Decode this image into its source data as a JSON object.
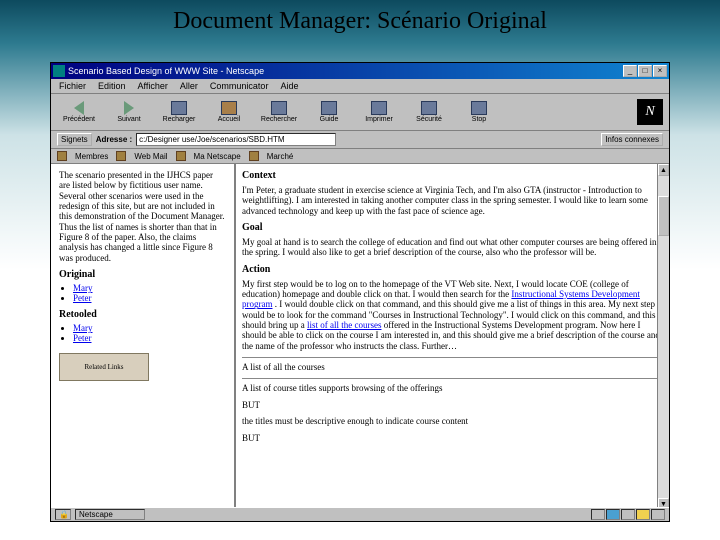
{
  "slide": {
    "title": "Document Manager: Scénario Original"
  },
  "window": {
    "title": "Scenario Based Design of WWW Site - Netscape",
    "controls": {
      "min": "_",
      "max": "□",
      "close": "×"
    }
  },
  "menubar": {
    "items": [
      "Fichier",
      "Edition",
      "Afficher",
      "Aller",
      "Communicator",
      "Aide"
    ]
  },
  "toolbar": {
    "items": [
      "Précédent",
      "Suivant",
      "Recharger",
      "Accueil",
      "Rechercher",
      "Guide",
      "Imprimer",
      "Sécurité",
      "Stop"
    ],
    "brand_glyph": "N"
  },
  "locationbar": {
    "bookmark_label": "Signets",
    "addr_label": "Adresse :",
    "addr_value": "c:/Designer use/Joe/scenarios/SBD.HTM",
    "related_label": "Infos connexes"
  },
  "quickbar": {
    "items": [
      "Membres",
      "Web Mail",
      "Ma Netscape",
      "Marché"
    ]
  },
  "left": {
    "intro": "The scenario presented in the IJHCS paper are listed below by fictitious user name. Several other scenarios were used in the redesign of this site, but are not included in this demonstration of the Document Manager. Thus the list of names is shorter than that in Figure 8 of the paper. Also, the claims analysis has changed a little since Figure 8 was produced.",
    "original_heading": "Original",
    "original_users": [
      "Mary",
      "Peter"
    ],
    "retooled_heading": "Retooled",
    "retooled_users": [
      "Mary",
      "Peter"
    ],
    "netlink_label": "Related Links"
  },
  "right": {
    "context_heading": "Context",
    "context_text": "I'm Peter, a graduate student in exercise science at Virginia Tech, and I'm also GTA (instructor - Introduction to weightlifting). I am interested in taking another computer class in the spring semester. I would like to learn some advanced technology and keep up with the fast pace of science age.",
    "goal_heading": "Goal",
    "goal_text": "My goal at hand is to search the college of education and find out what other computer courses are being offered in the spring. I would also like to get a brief description of the course, also who the professor will be.",
    "action_heading": "Action",
    "action_text_a": "My first step would be to log on to the homepage of the VT Web site. Next, I would locate COE (college of education) homepage and double click on that. I would then search for the ",
    "action_link1": "Instructional Systems Development program",
    "action_text_b": ". I would double click on that command, and this should give me a list of things in this area. My next step would be to look for the command \"Courses in Instructional Technology\". I would click on this command, and this should bring up a ",
    "action_link2": "list of all the courses",
    "action_text_c": " offered in the Instructional Systems Development program. Now here I should be able to click on the course I am interested in, and this should give me a brief description of the course and the name of the professor who instructs the class. Further…",
    "list_intro": "A list of all the courses",
    "claim1": "A list of course titles supports browsing of the offerings",
    "but1": "BUT",
    "explain1": "the titles must be descriptive enough to indicate course content",
    "but2": "BUT"
  },
  "statusbar": {
    "status": "Netscape"
  }
}
